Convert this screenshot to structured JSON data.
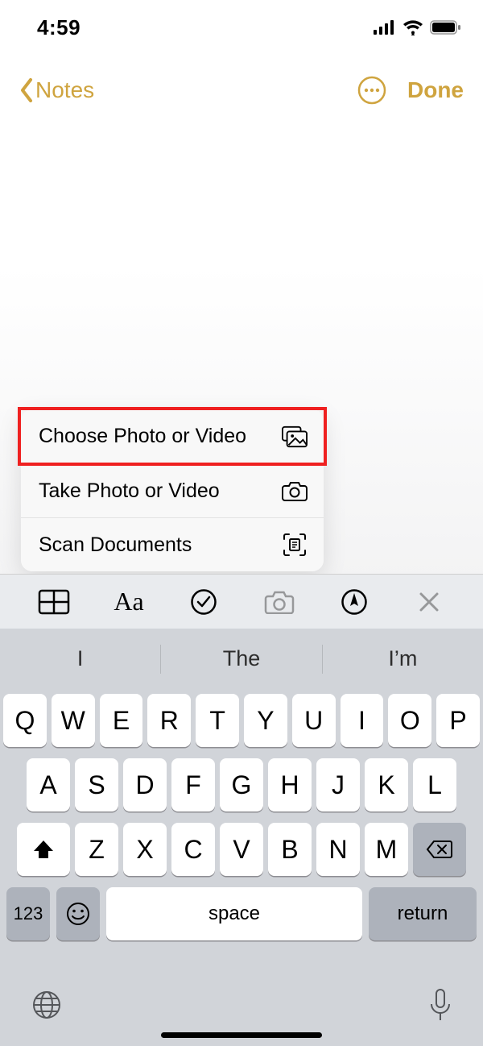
{
  "status": {
    "time": "4:59"
  },
  "nav": {
    "back_label": "Notes",
    "done_label": "Done"
  },
  "popup": {
    "items": [
      {
        "label": "Choose Photo or Video",
        "icon": "photo-library-icon",
        "highlighted": true
      },
      {
        "label": "Take Photo or Video",
        "icon": "camera-icon",
        "highlighted": false
      },
      {
        "label": "Scan Documents",
        "icon": "scan-document-icon",
        "highlighted": false
      }
    ]
  },
  "format_bar": {
    "items": [
      "table-icon",
      "text-format-icon",
      "checkmark-circle-icon",
      "camera-icon",
      "pen-circle-icon",
      "close-icon"
    ]
  },
  "keyboard": {
    "suggestions": [
      "I",
      "The",
      "I’m"
    ],
    "row1": [
      "Q",
      "W",
      "E",
      "R",
      "T",
      "Y",
      "U",
      "I",
      "O",
      "P"
    ],
    "row2": [
      "A",
      "S",
      "D",
      "F",
      "G",
      "H",
      "J",
      "K",
      "L"
    ],
    "row3": [
      "Z",
      "X",
      "C",
      "V",
      "B",
      "N",
      "M"
    ],
    "numeric_label": "123",
    "space_label": "space",
    "return_label": "return"
  }
}
